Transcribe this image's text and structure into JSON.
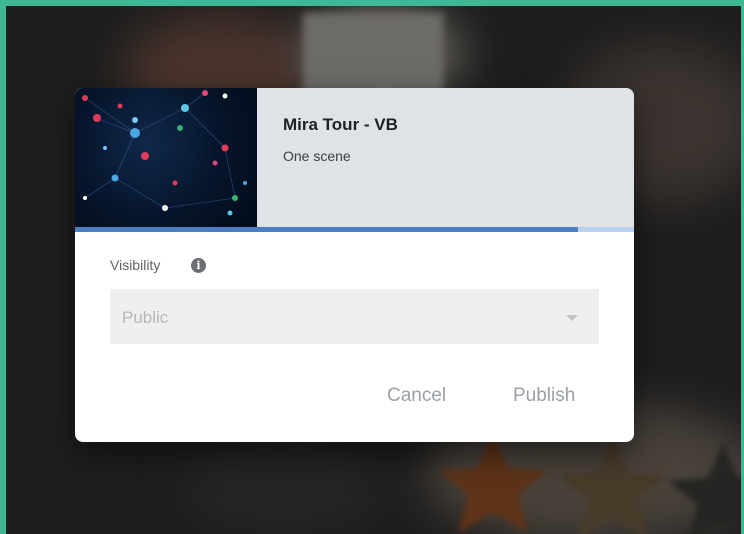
{
  "dialog": {
    "title": "Mira Tour - VB",
    "subtitle": "One scene",
    "progress_fraction": 0.9,
    "visibility_label": "Visibility",
    "info_glyph": "i",
    "select": {
      "value": "Public"
    },
    "cancel_label": "Cancel",
    "publish_label": "Publish"
  },
  "colors": {
    "frame": "#3fb896",
    "progress": "#4a7fc4",
    "progress_track": "#b9d0ec",
    "header_bg": "#dfe3e7",
    "button_text": "#9aa0a6"
  },
  "icons": {
    "info": "info-icon",
    "dropdown": "chevron-down-icon",
    "thumbnail": "network-graph-thumbnail"
  }
}
